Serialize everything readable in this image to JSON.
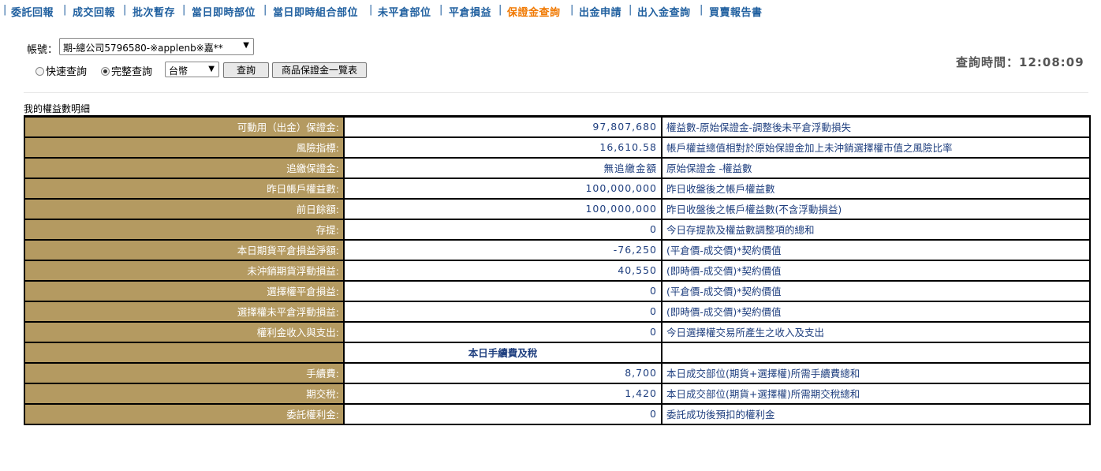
{
  "nav": [
    {
      "label": "委託回報",
      "active": false
    },
    {
      "label": "成交回報",
      "active": false
    },
    {
      "label": "批次暫存",
      "active": false
    },
    {
      "label": "當日即時部位",
      "active": false
    },
    {
      "label": "當日即時組合部位",
      "active": false
    },
    {
      "label": "未平倉部位",
      "active": false
    },
    {
      "label": "平倉損益",
      "active": false
    },
    {
      "label": "保證金查詢",
      "active": true
    },
    {
      "label": "出金申請",
      "active": false
    },
    {
      "label": "出入金查詢",
      "active": false
    },
    {
      "label": "買賣報告書",
      "active": false
    }
  ],
  "nav_separator": "|",
  "account": {
    "label": "帳號：",
    "selected": "期-總公司5796580-※applenb※嘉**"
  },
  "query_mode": {
    "quick": "快速查詢",
    "full": "完整查詢",
    "selected": "full"
  },
  "currency": {
    "selected": "台幣"
  },
  "buttons": {
    "query": "查詢",
    "margin_list": "商品保證金一覽表"
  },
  "query_time": {
    "label": "查詢時間：",
    "value": "12:08:09"
  },
  "section_title": "我的權益數明細",
  "rows": [
    {
      "label": "可動用（出金）保證金:",
      "value": "97,807,680",
      "desc": "權益數-原始保證金-調整後未平倉浮動損失"
    },
    {
      "label": "風險指標:",
      "value": "16,610.58",
      "desc": "帳戶權益總值相對於原始保證金加上未沖銷選擇權市值之風險比率"
    },
    {
      "label": "追繳保證金:",
      "value": "無追繳金額",
      "desc": "原始保證金 -權益數"
    },
    {
      "label": "昨日帳戶權益數:",
      "value": "100,000,000",
      "desc": "昨日收盤後之帳戶權益數"
    },
    {
      "label": "前日餘額:",
      "value": "100,000,000",
      "desc": "昨日收盤後之帳戶權益數(不含浮動損益)"
    },
    {
      "label": "存提:",
      "value": "0",
      "desc": "今日存提款及權益數調整項的總和"
    },
    {
      "label": "本日期貨平倉損益淨額:",
      "value": "-76,250",
      "desc": "(平倉價-成交價)*契約價值"
    },
    {
      "label": "未沖銷期貨浮動損益:",
      "value": "40,550",
      "desc": "(即時價-成交價)*契約價值"
    },
    {
      "label": "選擇權平倉損益:",
      "value": "0",
      "desc": "(平倉價-成交價)*契約價值"
    },
    {
      "label": "選擇權未平倉浮動損益:",
      "value": "0",
      "desc": "(即時價-成交價)*契約價值"
    },
    {
      "label": "權利金收入與支出:",
      "value": "0",
      "desc": "今日選擇權交易所產生之收入及支出"
    }
  ],
  "subheader": "本日手續費及稅",
  "rows2": [
    {
      "label": "手續費:",
      "value": "8,700",
      "desc": "本日成交部位(期貨+選擇權)所需手續費總和"
    },
    {
      "label": "期交稅:",
      "value": "1,420",
      "desc": "本日成交部位(期貨+選擇權)所需期交稅總和"
    },
    {
      "label": "委託權利金:",
      "value": "0",
      "desc": "委託成功後預扣的權利金"
    }
  ],
  "colors": {
    "label_bg": "#b49a61",
    "nav": "#1f5f9f",
    "nav_active": "#f07800",
    "value_text": "#1f3f7f"
  }
}
